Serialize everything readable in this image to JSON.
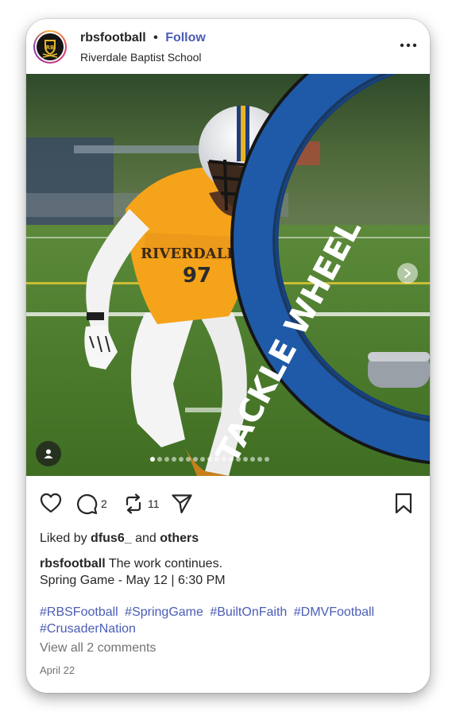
{
  "post": {
    "username": "rbsfootball",
    "separator": "•",
    "follow_label": "Follow",
    "location": "Riverdale Baptist School",
    "more_icon": "more-horizontal-icon"
  },
  "photo": {
    "jersey_text": "RIVERDALE",
    "jersey_number": "97",
    "pad_text": "TACKLE WHEEL",
    "carousel_total": 17,
    "carousel_active": 1
  },
  "actions": {
    "like_icon": "heart-icon",
    "comment_icon": "comment-icon",
    "comment_count": "2",
    "repost_icon": "repost-icon",
    "repost_count": "11",
    "share_icon": "send-icon",
    "save_icon": "bookmark-icon"
  },
  "likes": {
    "prefix": "Liked by",
    "user": "dfus6_",
    "conj": "and",
    "others": "others"
  },
  "caption": {
    "username": "rbsfootball",
    "line1": "The work continues.",
    "line2": "Spring Game - May 12 | 6:30 PM"
  },
  "hashtags": [
    "#RBSFootball",
    "#SpringGame",
    "#BuiltOnFaith",
    "#DMVFootball",
    "#CrusaderNation"
  ],
  "view_comments": "View all 2 comments",
  "date": "April 22",
  "colors": {
    "link": "#4a5db5",
    "jersey": "#f5a31a",
    "pad_blue": "#1f5aa8"
  }
}
